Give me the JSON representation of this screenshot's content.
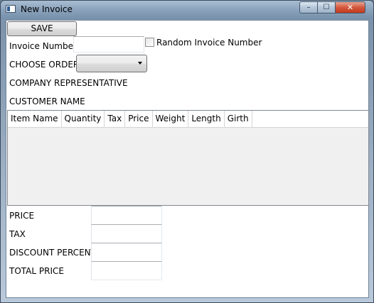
{
  "window": {
    "title": "New Invoice",
    "min_glyph": "–",
    "max_glyph": "☐",
    "close_glyph": "✕"
  },
  "toolbar": {
    "save_label": "SAVE"
  },
  "form": {
    "invoice_number_label": "Invoice Number",
    "invoice_number_value": "",
    "random_invoice_label": "Random Invoice Number",
    "random_invoice_checked": false,
    "choose_order_label": "CHOOSE ORDER",
    "choose_order_value": "",
    "company_rep_label": "COMPANY REPRESENTATIVE",
    "customer_name_label": "CUSTOMER NAME"
  },
  "grid": {
    "columns": [
      "Item Name",
      "Quantity",
      "Tax",
      "Price",
      "Weight",
      "Length",
      "Girth"
    ],
    "rows": []
  },
  "totals": {
    "price_label": "PRICE",
    "price_value": "",
    "tax_label": "TAX",
    "tax_value": "",
    "discount_label": "DISCOUNT PERCENT",
    "discount_value": "",
    "total_label": "TOTAL PRICE",
    "total_value": ""
  }
}
